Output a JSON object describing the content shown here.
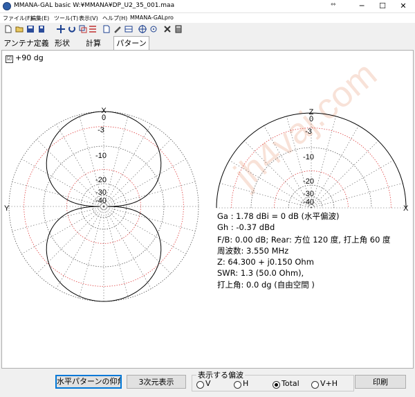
{
  "window": {
    "title": "MMANA-GAL basic  W:¥MMANA¥DP_U2_35_001.maa",
    "minimize": "─",
    "maximize": "☐",
    "close": "✕",
    "grip": "⇔"
  },
  "menu": [
    {
      "label": "ファイル(F)"
    },
    {
      "label": "編集(E)"
    },
    {
      "label": "ツール(T)"
    },
    {
      "label": "表示(V)"
    },
    {
      "label": "ヘルプ(H)"
    },
    {
      "label": "MMANA-GALpro"
    }
  ],
  "toolbar_icons": [
    "new-file-icon",
    "open-folder-icon",
    "save-icon",
    "save-as-icon",
    "move-icon",
    "rotate-icon",
    "copy-icon",
    "list-icon",
    "doc-icon",
    "edit-icon",
    "table-icon",
    "circle-cross-icon",
    "crosshair-icon",
    "tools-icon",
    "calculator-icon"
  ],
  "tabs": [
    {
      "label": "アンテナ定義"
    },
    {
      "label": "形状"
    },
    {
      "label": "計算"
    },
    {
      "label": "パターン",
      "active": true
    }
  ],
  "pattern": {
    "check_label": "+90 dg",
    "check_mark": "☑",
    "horizontal_plot": {
      "top_axis": "X",
      "left_axis": "Y",
      "ring_labels": [
        "0",
        "-3",
        "-10",
        "-20",
        "-30",
        "-40"
      ]
    },
    "vertical_plot": {
      "top_axis": "Z",
      "right_axis": "X",
      "ring_labels": [
        "0",
        "-3",
        "-10",
        "-20",
        "-30",
        "-40"
      ]
    },
    "watermark": "jh4vaj.com",
    "info": [
      "Ga : 1.78 dBi = 0 dB  (水平偏波)",
      "Gh : -0.37 dBd",
      "F/B: 0.00 dB; Rear: 方位 120 度, 打上角 60 度",
      "周波数: 3.550 MHz",
      "Z: 64.300 + j0.150 Ohm",
      "SWR: 1.3 (50.0 Ohm),",
      "打上角: 0.0 dg (自由空間 )"
    ]
  },
  "footer": {
    "elevation_button": "水平パターンの仰角",
    "view3d_button": "3次元表示",
    "polarization_group": "表示する偏波",
    "radios": [
      {
        "label": "V",
        "selected": false
      },
      {
        "label": "H",
        "selected": false
      },
      {
        "label": "Total",
        "selected": true
      },
      {
        "label": "V+H",
        "selected": false
      }
    ],
    "print_button": "印刷"
  },
  "colors": {
    "grid_dotted": "#555555",
    "ring_red": "#e04040",
    "pattern": "#000000",
    "focus_blue": "#0078d7"
  }
}
